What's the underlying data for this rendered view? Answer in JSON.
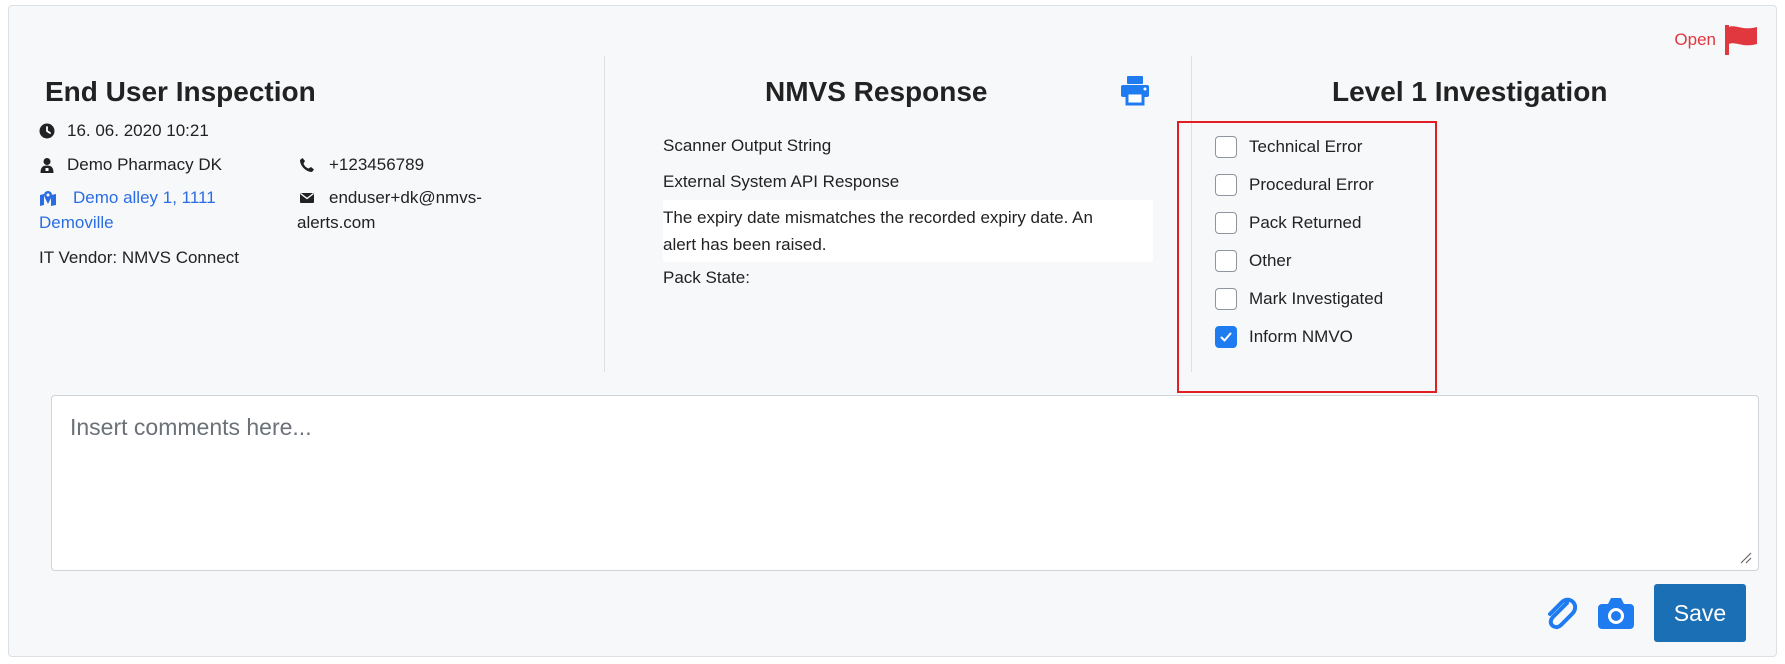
{
  "status": {
    "label": "Open",
    "flag_color": "#e0383e",
    "icon": "flag-icon"
  },
  "end_user_inspection": {
    "title": "End User Inspection",
    "datetime": "16. 06. 2020 10:21",
    "pharmacy": "Demo Pharmacy DK",
    "address_line1": "Demo alley 1, 1111",
    "address_line2": "Demoville",
    "it_vendor": "IT Vendor: NMVS Connect",
    "phone": "+123456789",
    "email_line1": "enduser+dk@nmvs-",
    "email_line2": "alerts.com"
  },
  "nmvs_response": {
    "title": "NMVS Response",
    "scanner_output": "Scanner Output String",
    "external_api": "External System API Response",
    "message_line1": "The expiry date mismatches the recorded expiry date. An",
    "message_line2": "alert has been raised.",
    "pack_state": "Pack State:"
  },
  "level1": {
    "title": "Level 1 Investigation",
    "options": [
      {
        "label": "Technical Error",
        "checked": false
      },
      {
        "label": "Procedural Error",
        "checked": false
      },
      {
        "label": "Pack Returned",
        "checked": false
      },
      {
        "label": "Other",
        "checked": false
      },
      {
        "label": "Mark Investigated",
        "checked": false
      },
      {
        "label": "Inform NMVO",
        "checked": true
      }
    ]
  },
  "comments": {
    "placeholder": "Insert comments here..."
  },
  "actions": {
    "save_label": "Save",
    "accent": "#1a6fb5",
    "icon_color": "#1f7cf0"
  }
}
